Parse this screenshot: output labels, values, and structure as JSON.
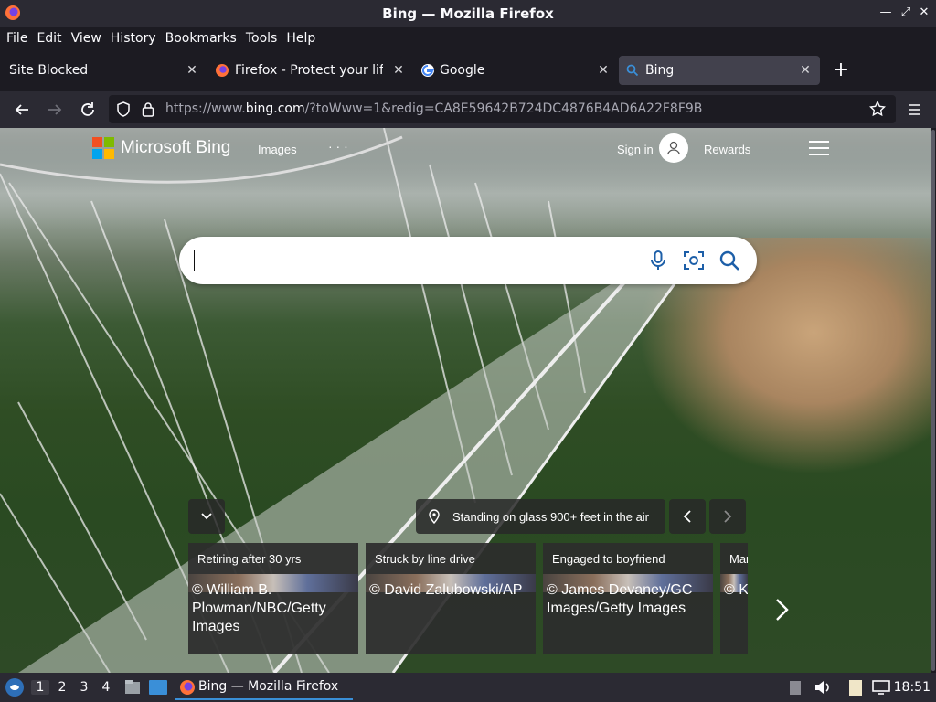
{
  "window": {
    "title": "Bing — Mozilla Firefox"
  },
  "menu": [
    "File",
    "Edit",
    "View",
    "History",
    "Bookmarks",
    "Tools",
    "Help"
  ],
  "tabs": [
    {
      "label": "Site Blocked",
      "icon": "none",
      "active": false
    },
    {
      "label": "Firefox - Protect your life",
      "icon": "firefox-icon",
      "active": false
    },
    {
      "label": "Google",
      "icon": "google-icon",
      "active": false
    },
    {
      "label": "Bing",
      "icon": "search-icon",
      "active": true
    }
  ],
  "nav": {
    "url_prefix": "https://www.",
    "url_domain": "bing.com",
    "url_rest": "/?toWww=1&redig=CA8E59642B724DC4876B4AD6A22F8F9B"
  },
  "bing": {
    "brand": "Microsoft Bing",
    "nav_images": "Images",
    "more": "· · ·",
    "sign_in": "Sign in",
    "rewards": "Rewards",
    "search_value": "",
    "image_caption": "Standing on glass 900+ feet in the air"
  },
  "cards": [
    {
      "title": "Retiring after 30 yrs",
      "credit": "© William B. Plowman/NBC/Getty Images"
    },
    {
      "title": "Struck by line drive",
      "credit": "© David Zalubowski/AP"
    },
    {
      "title": "Engaged to boyfriend",
      "credit": "© James Devaney/GC Images/Getty Images"
    },
    {
      "title": "Mar",
      "credit": "© K"
    }
  ],
  "taskbar": {
    "workspaces": [
      "1",
      "2",
      "3",
      "4"
    ],
    "active_task": "Bing — Mozilla Firefox",
    "clock": "18:51"
  },
  "colors": {
    "accent": "#3a8fd8",
    "bing_blue": "#1d5fa8"
  }
}
